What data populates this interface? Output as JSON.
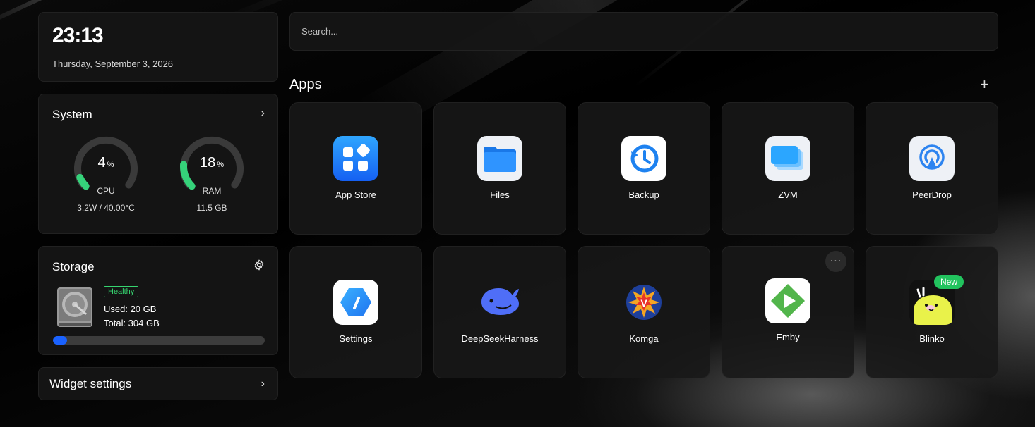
{
  "clock": {
    "time": "23:13",
    "date": "Thursday, September 3, 2026"
  },
  "system": {
    "title": "System",
    "cpu": {
      "value": "4",
      "unit": "%",
      "label": "CPU",
      "detail": "3.2W / 40.00°C",
      "percent": 4
    },
    "ram": {
      "value": "18",
      "unit": "%",
      "label": "RAM",
      "detail": "11.5 GB",
      "percent": 18
    },
    "gauge_color": "#35d27a"
  },
  "storage": {
    "title": "Storage",
    "status": "Healthy",
    "used": "Used: 20 GB",
    "total": "Total: 304 GB",
    "used_fraction": 0.066,
    "bar_color": "#1a62ff"
  },
  "widget_settings": {
    "label": "Widget settings"
  },
  "search": {
    "placeholder": "Search..."
  },
  "apps": {
    "title": "Apps",
    "add_label": "+",
    "items": [
      {
        "name": "App Store",
        "icon": "app-store-icon"
      },
      {
        "name": "Files",
        "icon": "folder-icon"
      },
      {
        "name": "Backup",
        "icon": "backup-clock-icon"
      },
      {
        "name": "ZVM",
        "icon": "zvm-icon"
      },
      {
        "name": "PeerDrop",
        "icon": "airdrop-icon"
      },
      {
        "name": "Settings",
        "icon": "settings-icon"
      },
      {
        "name": "DeepSeekHarness",
        "icon": "whale-icon"
      },
      {
        "name": "Komga",
        "icon": "komga-icon"
      },
      {
        "name": "Emby",
        "icon": "emby-icon",
        "menu": "···"
      },
      {
        "name": "Blinko",
        "icon": "blinko-icon",
        "badge": "New"
      }
    ]
  }
}
